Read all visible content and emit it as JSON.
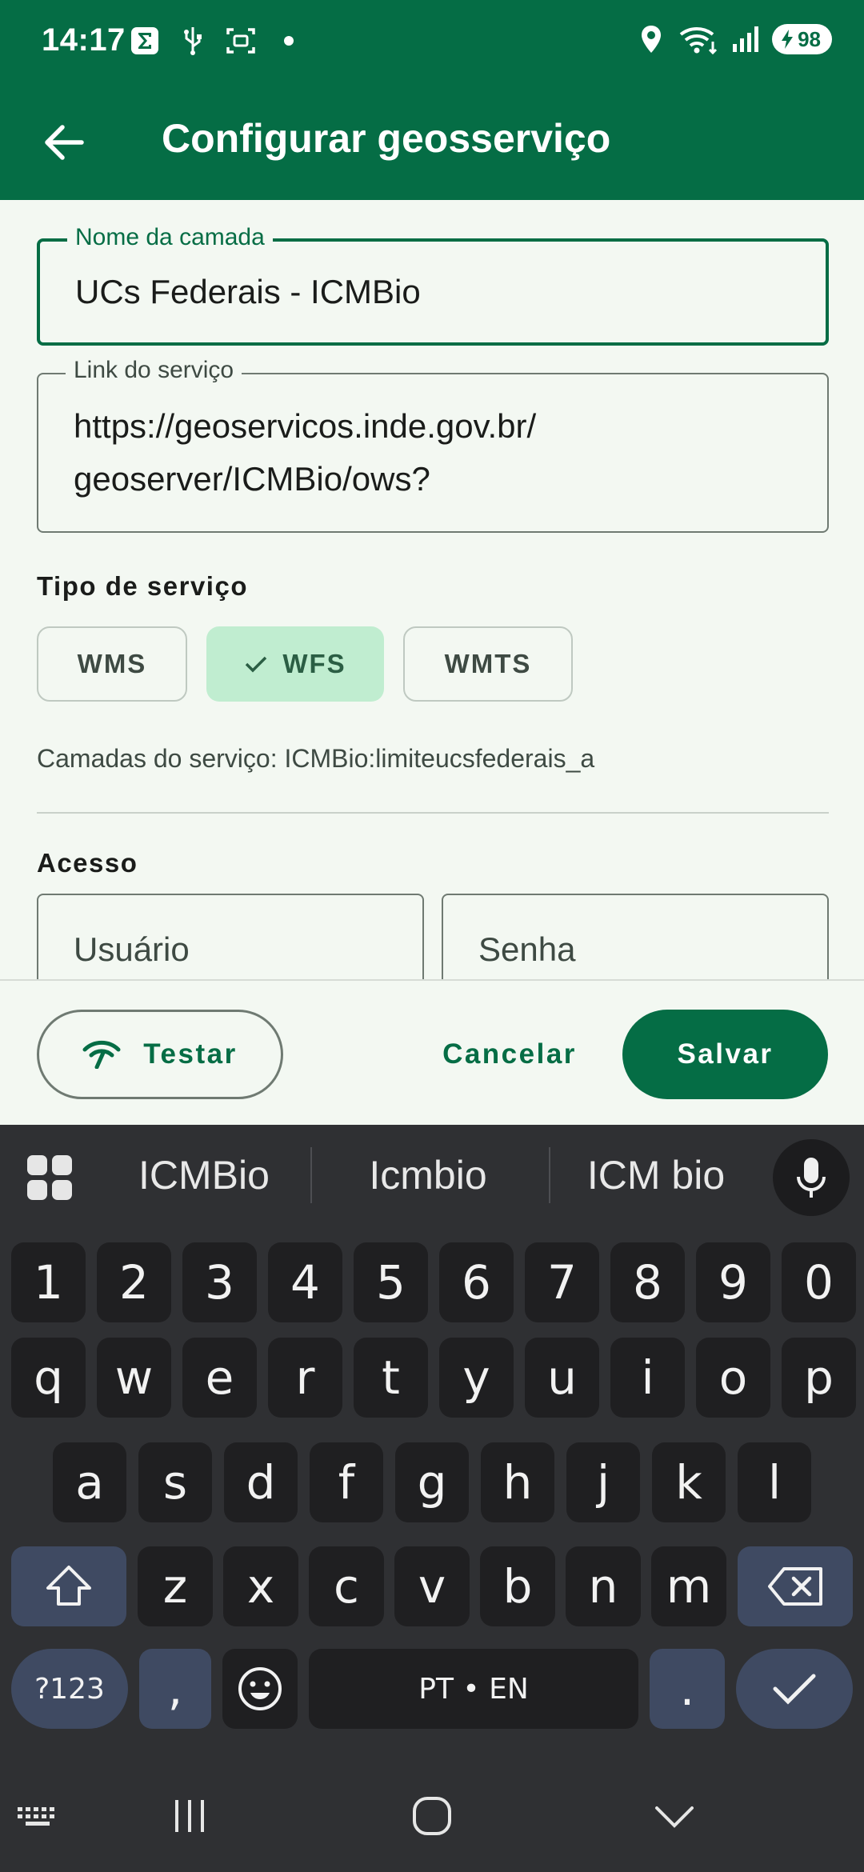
{
  "status_bar": {
    "time": "14:17",
    "battery": "98",
    "icons": [
      "sigma-icon",
      "usb-icon",
      "screenshot-icon",
      "dot-icon",
      "location-icon",
      "wifi-icon",
      "signal-icon",
      "battery-icon"
    ]
  },
  "app_bar": {
    "title": "Configurar geosserviço",
    "back_icon": "arrow-left-icon"
  },
  "form": {
    "layer_name": {
      "label": "Nome da camada",
      "value": "UCs Federais - ICMBio"
    },
    "service_link": {
      "label": "Link do serviço",
      "value": "https://geoservicos.inde.gov.br/\ngeoserver/ICMBio/ows?"
    },
    "service_type": {
      "label": "Tipo de serviço",
      "options": [
        "WMS",
        "WFS",
        "WMTS"
      ],
      "selected": "WFS"
    },
    "layers_text": "Camadas do serviço: ICMBio:limiteucsfederais_a",
    "access": {
      "label": "Acesso",
      "user_placeholder": "Usuário",
      "password_placeholder": "Senha"
    }
  },
  "actions": {
    "test_label": "Testar",
    "cancel_label": "Cancelar",
    "save_label": "Salvar"
  },
  "keyboard": {
    "suggestions": [
      "ICMBio",
      "Icmbio",
      "ICM bio"
    ],
    "row_numbers": [
      "1",
      "2",
      "3",
      "4",
      "5",
      "6",
      "7",
      "8",
      "9",
      "0"
    ],
    "row_1": [
      "q",
      "w",
      "e",
      "r",
      "t",
      "y",
      "u",
      "i",
      "o",
      "p"
    ],
    "row_2": [
      "a",
      "s",
      "d",
      "f",
      "g",
      "h",
      "j",
      "k",
      "l"
    ],
    "row_3": [
      "z",
      "x",
      "c",
      "v",
      "b",
      "n",
      "m"
    ],
    "symbols_key": "?123",
    "comma_key": ",",
    "space_label": "PT • EN",
    "period_key": "."
  },
  "colors": {
    "primary": "#056d45",
    "selected_chip": "#c0edd0",
    "background": "#f3f8f2",
    "keyboard_bg": "#2f3033"
  }
}
